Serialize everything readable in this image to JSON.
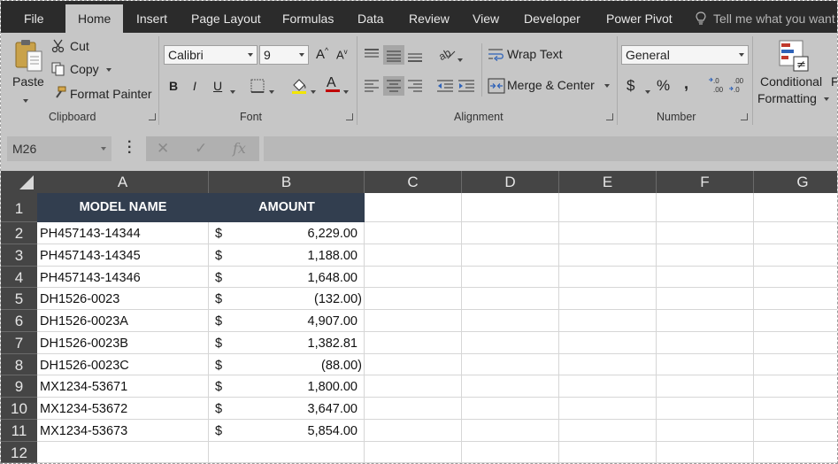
{
  "tabs": [
    "File",
    "Home",
    "Insert",
    "Page Layout",
    "Formulas",
    "Data",
    "Review",
    "View",
    "Developer",
    "Power Pivot"
  ],
  "active_tab": "Home",
  "tell_me": "Tell me what you want",
  "clipboard": {
    "paste": "Paste",
    "cut": "Cut",
    "copy": "Copy",
    "format_painter": "Format Painter",
    "label": "Clipboard"
  },
  "font": {
    "name": "Calibri",
    "size": "9",
    "bold": "B",
    "italic": "I",
    "underline": "U",
    "label": "Font"
  },
  "alignment": {
    "wrap_text": "Wrap Text",
    "merge_center": "Merge & Center",
    "label": "Alignment"
  },
  "number": {
    "format": "General",
    "currency": "$",
    "percent": "%",
    "comma": ",",
    "label": "Number"
  },
  "styles": {
    "conditional_line1": "Conditional",
    "conditional_line2": "Formatting",
    "next_partial": "F"
  },
  "formula_bar": {
    "name_box": "M26",
    "fx": "fx",
    "value": ""
  },
  "columns": [
    "A",
    "B",
    "C",
    "D",
    "E",
    "F",
    "G"
  ],
  "rows": [
    "1",
    "2",
    "3",
    "4",
    "5",
    "6",
    "7",
    "8",
    "9",
    "10",
    "11",
    "12"
  ],
  "table": {
    "headers": [
      "MODEL NAME",
      "AMOUNT"
    ],
    "currency_symbol": "$",
    "rows": [
      {
        "model": "PH457143-14344",
        "amount": "6,229.00"
      },
      {
        "model": "PH457143-14345",
        "amount": "1,188.00"
      },
      {
        "model": "PH457143-14346",
        "amount": "1,648.00"
      },
      {
        "model": "DH1526-0023",
        "amount": "(132.00)"
      },
      {
        "model": "DH1526-0023A",
        "amount": "4,907.00"
      },
      {
        "model": "DH1526-0023B",
        "amount": "1,382.81"
      },
      {
        "model": "DH1526-0023C",
        "amount": "(88.00)"
      },
      {
        "model": "MX1234-53671",
        "amount": "1,800.00"
      },
      {
        "model": "MX1234-53672",
        "amount": "3,647.00"
      },
      {
        "model": "MX1234-53673",
        "amount": "5,854.00"
      }
    ]
  },
  "colors": {
    "ribbon_bg": "#c6c6c6",
    "tab_bar_bg": "#2b2b2b",
    "header_fill": "#323e4f",
    "grid_header_bg": "#454545"
  }
}
